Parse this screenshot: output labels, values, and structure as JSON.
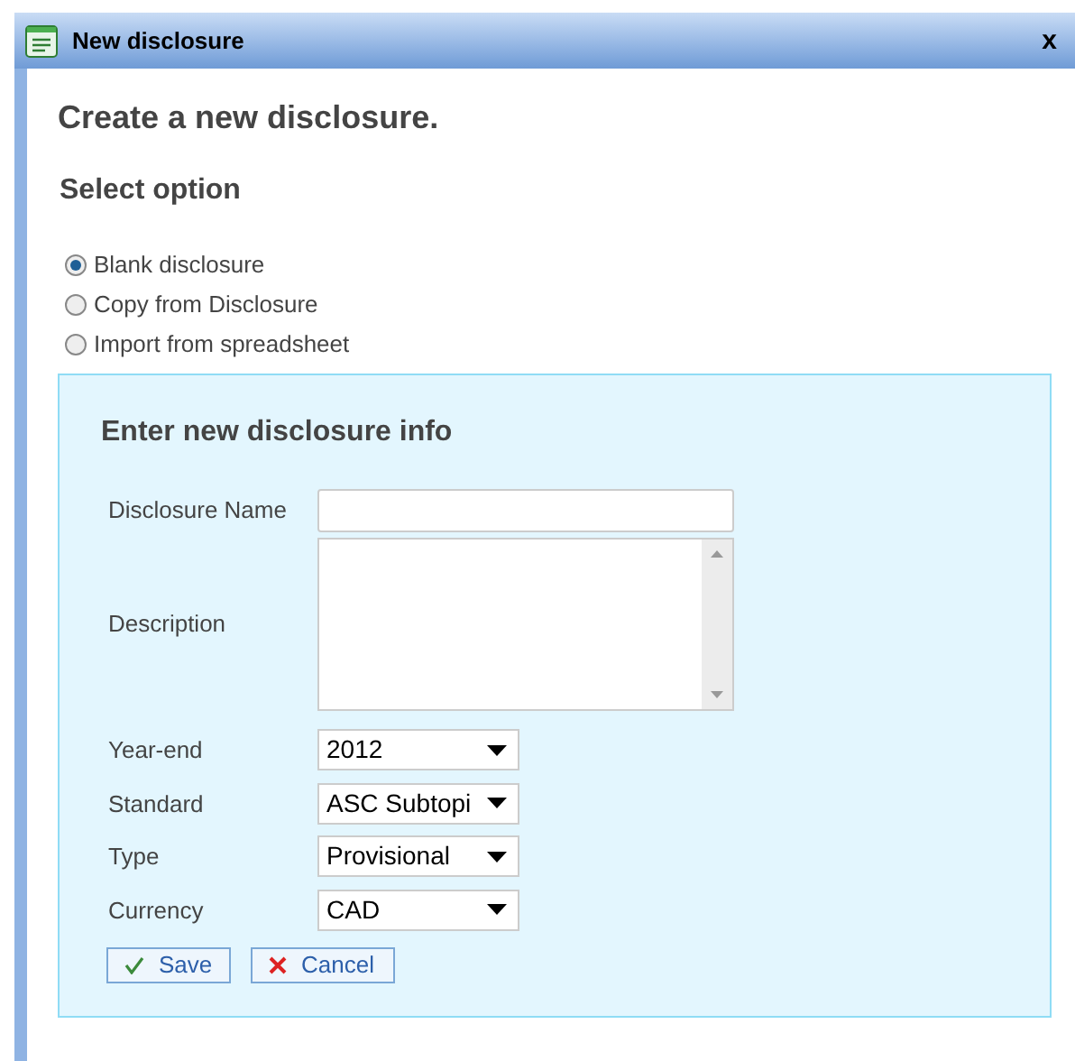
{
  "window": {
    "title": "New disclosure",
    "close": "x"
  },
  "heading": "Create a new disclosure.",
  "section_title": "Select option",
  "options": [
    {
      "label": "Blank disclosure",
      "selected": true
    },
    {
      "label": "Copy from Disclosure",
      "selected": false
    },
    {
      "label": "Import from spreadsheet",
      "selected": false
    }
  ],
  "panel": {
    "title": "Enter new disclosure info",
    "fields": [
      {
        "kind": "text",
        "label": "Disclosure Name"
      },
      {
        "kind": "textarea",
        "label": "Description"
      },
      {
        "kind": "select",
        "label": "Year-end",
        "value": "2012"
      },
      {
        "kind": "select",
        "label": "Standard",
        "value": "ASC Subtopi"
      },
      {
        "kind": "select",
        "label": "Type",
        "value": "Provisional"
      },
      {
        "kind": "select",
        "label": "Currency",
        "value": "CAD"
      }
    ],
    "buttons": [
      {
        "kind": "save",
        "label": "Save"
      },
      {
        "kind": "cancel",
        "label": "Cancel"
      }
    ]
  }
}
